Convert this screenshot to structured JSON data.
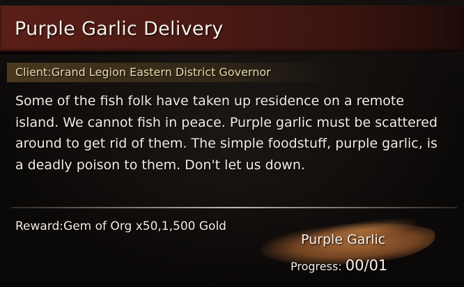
{
  "quest": {
    "title": "Purple Garlic Delivery",
    "client_label": "Client:",
    "client_name": "Grand Legion Eastern District Governor",
    "description": "Some of the fish folk have taken up residence on a remote island. We cannot fish in peace. Purple garlic must be scattered around to get rid of them. The simple foodstuff, purple garlic, is a deadly poison to them. Don't let us down.",
    "reward_label": "Reward:",
    "reward_value": "Gem of Org x50,1,500 Gold",
    "objective_name": "Purple Garlic",
    "progress_label": "Progress:",
    "progress_count": "00/01"
  },
  "colors": {
    "title_bar": "#5a1f18",
    "client_band": "#5c4826",
    "objective_brush": "#c0783e"
  }
}
